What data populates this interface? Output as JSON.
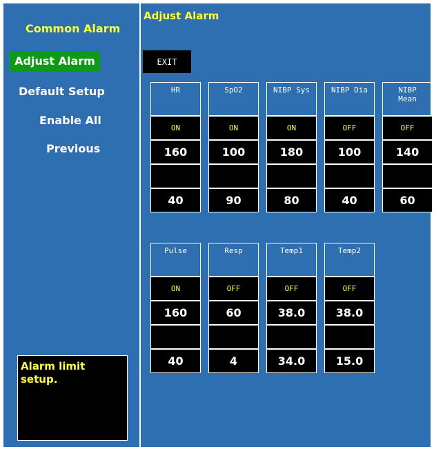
{
  "left_menu": {
    "title": "Common Alarm",
    "items": [
      {
        "label": "Adjust Alarm",
        "active": true
      },
      {
        "label": "Default Setup",
        "active": false
      },
      {
        "label": "Enable All",
        "active": false
      },
      {
        "label": "Previous",
        "active": false
      }
    ],
    "help_text": "Alarm limit\nsetup."
  },
  "panel": {
    "title": "Adjust Alarm",
    "exit_label": "EXIT"
  },
  "params_row1": [
    {
      "name": "HR",
      "state": "ON",
      "high": "160",
      "low": "40"
    },
    {
      "name": "SpO2",
      "state": "ON",
      "high": "100",
      "low": "90"
    },
    {
      "name": "NIBP Sys",
      "state": "ON",
      "high": "180",
      "low": "80"
    },
    {
      "name": "NIBP Dia",
      "state": "OFF",
      "high": "100",
      "low": "40"
    },
    {
      "name": "NIBP\nMean",
      "state": "OFF",
      "high": "140",
      "low": "60"
    }
  ],
  "params_row2": [
    {
      "name": "Pulse",
      "state": "ON",
      "high": "160",
      "low": "40"
    },
    {
      "name": "Resp",
      "state": "OFF",
      "high": "60",
      "low": "4"
    },
    {
      "name": "Temp1",
      "state": "OFF",
      "high": "38.0",
      "low": "34.0"
    },
    {
      "name": "Temp2",
      "state": "OFF",
      "high": "38.0",
      "low": "15.0"
    }
  ],
  "colors": {
    "background": "#2e6fb1",
    "title": "#ffff33",
    "active_menu": "#0f9a15",
    "cell": "#000000"
  }
}
